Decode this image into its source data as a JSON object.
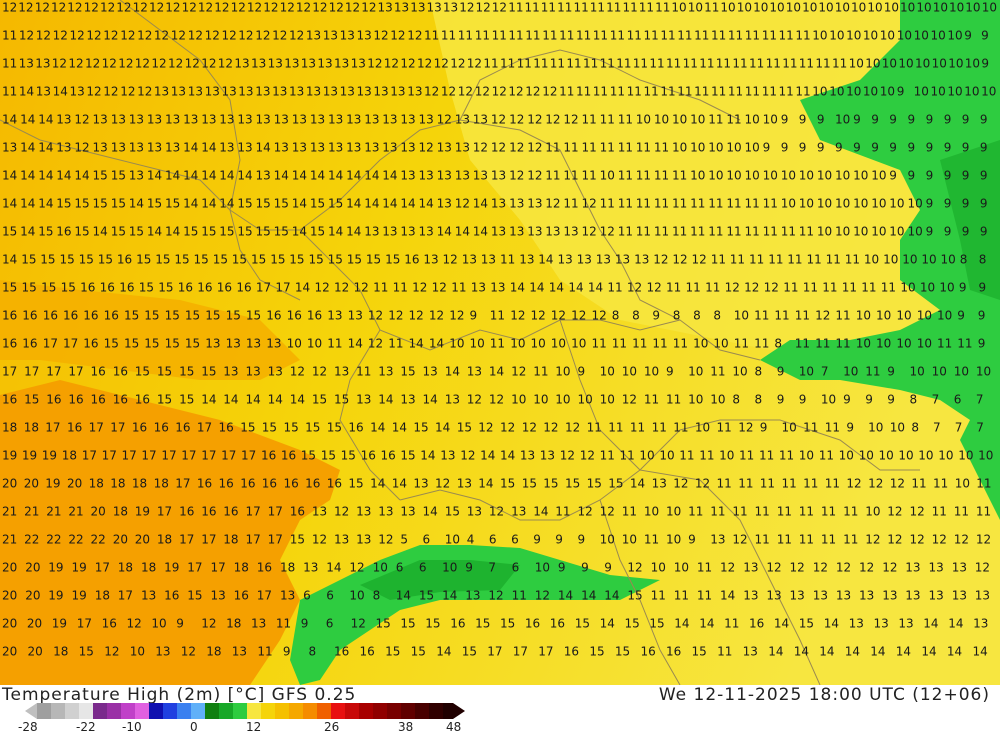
{
  "map": {
    "grid_rows": [
      {
        "values": [
          12,
          12,
          12,
          12,
          12,
          12,
          12,
          12,
          12,
          12,
          12,
          12,
          12,
          12,
          12,
          12,
          12,
          12,
          12,
          12,
          12,
          12,
          12,
          13,
          13,
          13,
          13,
          13,
          12,
          12,
          12,
          11,
          11,
          11,
          11,
          11,
          11,
          11,
          11,
          11,
          11,
          10,
          10,
          11,
          10,
          10,
          10,
          10,
          10,
          10,
          10,
          10,
          10,
          10,
          10,
          10,
          10,
          10,
          10,
          10,
          10
        ]
      },
      {
        "values": [
          11,
          12,
          12,
          12,
          12,
          12,
          12,
          12,
          12,
          12,
          12,
          12,
          12,
          12,
          12,
          12,
          12,
          12,
          13,
          13,
          13,
          13,
          12,
          12,
          12,
          11,
          11,
          11,
          11,
          11,
          11,
          11,
          11,
          11,
          11,
          11,
          11,
          11,
          11,
          11,
          11,
          11,
          11,
          11,
          11,
          11,
          11,
          11,
          10,
          10,
          10,
          10,
          10,
          10,
          10,
          10,
          10,
          9,
          9
        ]
      },
      {
        "values": [
          11,
          13,
          13,
          12,
          12,
          12,
          12,
          12,
          12,
          12,
          12,
          12,
          12,
          12,
          13,
          13,
          13,
          13,
          13,
          13,
          13,
          13,
          12,
          12,
          12,
          12,
          12,
          12,
          12,
          11,
          11,
          11,
          11,
          11,
          11,
          11,
          11,
          11,
          11,
          11,
          11,
          11,
          11,
          11,
          11,
          11,
          11,
          11,
          11,
          11,
          11,
          10,
          10,
          10,
          10,
          10,
          10,
          10,
          10,
          9
        ]
      },
      {
        "values": [
          11,
          14,
          13,
          14,
          13,
          12,
          12,
          12,
          12,
          13,
          13,
          13,
          13,
          13,
          13,
          13,
          13,
          13,
          13,
          13,
          13,
          13,
          13,
          13,
          13,
          12,
          12,
          12,
          12,
          12,
          12,
          12,
          12,
          11,
          11,
          11,
          11,
          11,
          11,
          11,
          11,
          11,
          11,
          11,
          11,
          11,
          11,
          11,
          10,
          10,
          10,
          10,
          10,
          9,
          10,
          10,
          10,
          10,
          10
        ]
      },
      {
        "values": [
          14,
          14,
          14,
          13,
          12,
          13,
          13,
          13,
          13,
          13,
          13,
          13,
          13,
          13,
          13,
          13,
          13,
          13,
          13,
          13,
          13,
          13,
          13,
          13,
          12,
          13,
          13,
          12,
          12,
          12,
          12,
          12,
          11,
          11,
          11,
          10,
          10,
          10,
          10,
          11,
          11,
          10,
          10,
          9,
          9,
          9,
          10,
          9,
          9,
          9,
          9,
          9,
          9,
          9,
          9
        ]
      },
      {
        "values": [
          13,
          14,
          14,
          13,
          12,
          13,
          13,
          13,
          13,
          13,
          14,
          14,
          13,
          13,
          14,
          13,
          13,
          13,
          13,
          13,
          13,
          13,
          13,
          12,
          13,
          13,
          12,
          12,
          12,
          12,
          11,
          11,
          11,
          11,
          11,
          11,
          11,
          10,
          10,
          10,
          10,
          10,
          9,
          9,
          9,
          9,
          9,
          9,
          9,
          9,
          9,
          9,
          9,
          9,
          9
        ]
      },
      {
        "values": [
          14,
          14,
          14,
          14,
          14,
          15,
          15,
          13,
          14,
          14,
          14,
          14,
          14,
          14,
          13,
          14,
          14,
          14,
          14,
          14,
          14,
          14,
          13,
          13,
          13,
          13,
          13,
          13,
          12,
          12,
          11,
          11,
          11,
          10,
          11,
          11,
          11,
          11,
          10,
          10,
          10,
          10,
          10,
          10,
          10,
          10,
          10,
          10,
          10,
          9,
          9,
          9,
          9,
          9,
          9
        ]
      },
      {
        "values": [
          14,
          14,
          14,
          15,
          15,
          15,
          15,
          14,
          15,
          15,
          14,
          14,
          14,
          15,
          15,
          15,
          14,
          15,
          15,
          14,
          14,
          14,
          14,
          14,
          13,
          12,
          14,
          13,
          13,
          13,
          12,
          11,
          12,
          11,
          11,
          11,
          11,
          11,
          11,
          11,
          11,
          11,
          11,
          10,
          10,
          10,
          10,
          10,
          10,
          10,
          10,
          9,
          9,
          9,
          9
        ]
      },
      {
        "values": [
          15,
          14,
          15,
          16,
          15,
          14,
          15,
          15,
          14,
          14,
          15,
          15,
          15,
          15,
          15,
          15,
          14,
          15,
          14,
          14,
          13,
          13,
          13,
          13,
          14,
          14,
          14,
          13,
          13,
          13,
          13,
          13,
          12,
          12,
          11,
          11,
          11,
          11,
          11,
          11,
          11,
          11,
          11,
          11,
          11,
          10,
          10,
          10,
          10,
          10,
          10,
          9,
          9,
          9,
          9
        ]
      },
      {
        "values": [
          14,
          15,
          15,
          15,
          15,
          15,
          16,
          15,
          15,
          15,
          15,
          15,
          15,
          15,
          15,
          15,
          15,
          15,
          15,
          15,
          15,
          16,
          13,
          12,
          13,
          13,
          11,
          13,
          14,
          13,
          13,
          13,
          13,
          13,
          12,
          12,
          12,
          11,
          11,
          11,
          11,
          11,
          11,
          11,
          11,
          10,
          10,
          10,
          10,
          10,
          8,
          8
        ]
      },
      {
        "values": [
          15,
          15,
          15,
          15,
          16,
          16,
          16,
          15,
          15,
          16,
          16,
          16,
          16,
          17,
          17,
          14,
          12,
          12,
          12,
          11,
          11,
          12,
          12,
          11,
          13,
          13,
          14,
          14,
          14,
          14,
          14,
          11,
          12,
          12,
          11,
          11,
          11,
          12,
          12,
          12,
          11,
          11,
          11,
          11,
          11,
          11,
          10,
          10,
          10,
          9,
          9
        ]
      },
      {
        "values": [
          16,
          16,
          16,
          16,
          16,
          16,
          15,
          15,
          15,
          15,
          15,
          15,
          15,
          16,
          16,
          16,
          13,
          13,
          12,
          12,
          12,
          12,
          12,
          9,
          11,
          12,
          12,
          12,
          12,
          12,
          8,
          8,
          9,
          8,
          8,
          8,
          10,
          11,
          11,
          11,
          12,
          11,
          10,
          10,
          10,
          10,
          10,
          9,
          9
        ]
      },
      {
        "values": [
          16,
          16,
          17,
          17,
          16,
          15,
          15,
          15,
          15,
          15,
          13,
          13,
          13,
          13,
          10,
          10,
          11,
          14,
          12,
          11,
          14,
          14,
          10,
          10,
          11,
          10,
          10,
          10,
          10,
          11,
          11,
          11,
          11,
          11,
          10,
          10,
          11,
          11,
          8,
          11,
          11,
          11,
          10,
          10,
          10,
          10,
          11,
          11,
          9
        ]
      },
      {
        "values": [
          17,
          17,
          17,
          17,
          16,
          16,
          15,
          15,
          15,
          15,
          13,
          13,
          13,
          12,
          12,
          13,
          11,
          13,
          15,
          13,
          14,
          13,
          14,
          12,
          11,
          10,
          9,
          10,
          10,
          10,
          9,
          10,
          11,
          10,
          8,
          9,
          10,
          7,
          10,
          11,
          9,
          10,
          10,
          10,
          10
        ]
      },
      {
        "values": [
          16,
          15,
          16,
          16,
          16,
          16,
          16,
          15,
          15,
          14,
          14,
          14,
          14,
          14,
          15,
          15,
          13,
          14,
          13,
          14,
          13,
          12,
          12,
          10,
          10,
          10,
          10,
          10,
          12,
          11,
          11,
          10,
          10,
          8,
          8,
          9,
          9,
          10,
          9,
          9,
          9,
          8,
          7,
          6,
          7
        ]
      },
      {
        "values": [
          18,
          18,
          17,
          16,
          17,
          17,
          16,
          16,
          16,
          17,
          16,
          15,
          15,
          15,
          15,
          15,
          16,
          14,
          14,
          15,
          14,
          15,
          12,
          12,
          12,
          12,
          12,
          11,
          11,
          11,
          11,
          11,
          10,
          11,
          12,
          9,
          10,
          11,
          11,
          9,
          10,
          10,
          8,
          7,
          7,
          7
        ]
      },
      {
        "values": [
          19,
          19,
          19,
          18,
          17,
          17,
          17,
          17,
          17,
          17,
          17,
          17,
          17,
          16,
          16,
          15,
          15,
          15,
          16,
          16,
          15,
          14,
          13,
          12,
          14,
          14,
          13,
          13,
          12,
          12,
          11,
          11,
          10,
          10,
          11,
          11,
          10,
          11,
          11,
          11,
          10,
          11,
          10,
          10,
          10,
          10,
          10,
          10,
          10,
          10
        ]
      },
      {
        "values": [
          20,
          20,
          19,
          20,
          18,
          18,
          18,
          18,
          17,
          16,
          16,
          16,
          16,
          16,
          16,
          16,
          15,
          14,
          14,
          13,
          12,
          13,
          14,
          15,
          15,
          15,
          15,
          15,
          15,
          14,
          13,
          12,
          12,
          11,
          11,
          11,
          11,
          11,
          11,
          12,
          12,
          12,
          11,
          11,
          10,
          11
        ]
      },
      {
        "values": [
          21,
          21,
          21,
          21,
          20,
          18,
          19,
          17,
          16,
          16,
          16,
          17,
          17,
          16,
          13,
          12,
          13,
          13,
          13,
          14,
          15,
          13,
          12,
          13,
          14,
          11,
          12,
          12,
          11,
          10,
          10,
          11,
          11,
          11,
          11,
          11,
          11,
          11,
          11,
          10,
          12,
          12,
          11,
          11,
          11
        ]
      },
      {
        "values": [
          21,
          22,
          22,
          22,
          22,
          20,
          20,
          18,
          17,
          17,
          18,
          17,
          17,
          15,
          12,
          13,
          13,
          12,
          5,
          6,
          10,
          4,
          6,
          6,
          9,
          9,
          9,
          10,
          10,
          11,
          10,
          9,
          13,
          12,
          11,
          11,
          11,
          11,
          11,
          12,
          12,
          12,
          12,
          12,
          12
        ]
      },
      {
        "values": [
          20,
          20,
          19,
          19,
          17,
          18,
          18,
          19,
          17,
          17,
          18,
          16,
          18,
          13,
          14,
          12,
          10,
          6,
          6,
          10,
          9,
          7,
          6,
          10,
          9,
          9,
          9,
          12,
          10,
          10,
          11,
          12,
          13,
          12,
          12,
          12,
          12,
          12,
          12,
          13,
          13,
          13,
          12
        ]
      },
      {
        "values": [
          20,
          20,
          19,
          19,
          18,
          17,
          13,
          16,
          15,
          13,
          16,
          17,
          13,
          6,
          6,
          10,
          8,
          14,
          15,
          14,
          13,
          12,
          11,
          12,
          14,
          14,
          14,
          15,
          11,
          11,
          11,
          14,
          13,
          13,
          13,
          13,
          13,
          13,
          13,
          13,
          13,
          13,
          13
        ]
      },
      {
        "values": [
          20,
          20,
          19,
          17,
          16,
          12,
          10,
          9,
          12,
          18,
          13,
          11,
          9,
          6,
          12,
          15,
          15,
          15,
          16,
          15,
          15,
          16,
          16,
          15,
          14,
          15,
          15,
          14,
          14,
          11,
          16,
          14,
          15,
          14,
          13,
          13,
          13,
          14,
          14,
          13
        ]
      },
      {
        "values": [
          20,
          20,
          18,
          15,
          12,
          10,
          13,
          12,
          18,
          13,
          11,
          9,
          8,
          16,
          16,
          15,
          15,
          14,
          15,
          17,
          17,
          17,
          16,
          15,
          15,
          16,
          16,
          15,
          11,
          13,
          14,
          14,
          14,
          14,
          14,
          14,
          14,
          14,
          14
        ]
      }
    ]
  },
  "footer": {
    "title": "Temperature High (2m) [°C] GFS 0.25",
    "timestamp": "We 12-11-2025 18:00 UTC (12+06)",
    "scale_labels": [
      "-28",
      "-22",
      "-10",
      "0",
      "12",
      "26",
      "38",
      "48"
    ]
  },
  "colors": {
    "warm_yellow": "#f5d40a",
    "orange": "#f5a000",
    "light_yellow": "#f7e640",
    "green": "#2ecc40",
    "dark_green": "#18a828",
    "border": "#9a8a50",
    "label": "#1a1a1a"
  }
}
